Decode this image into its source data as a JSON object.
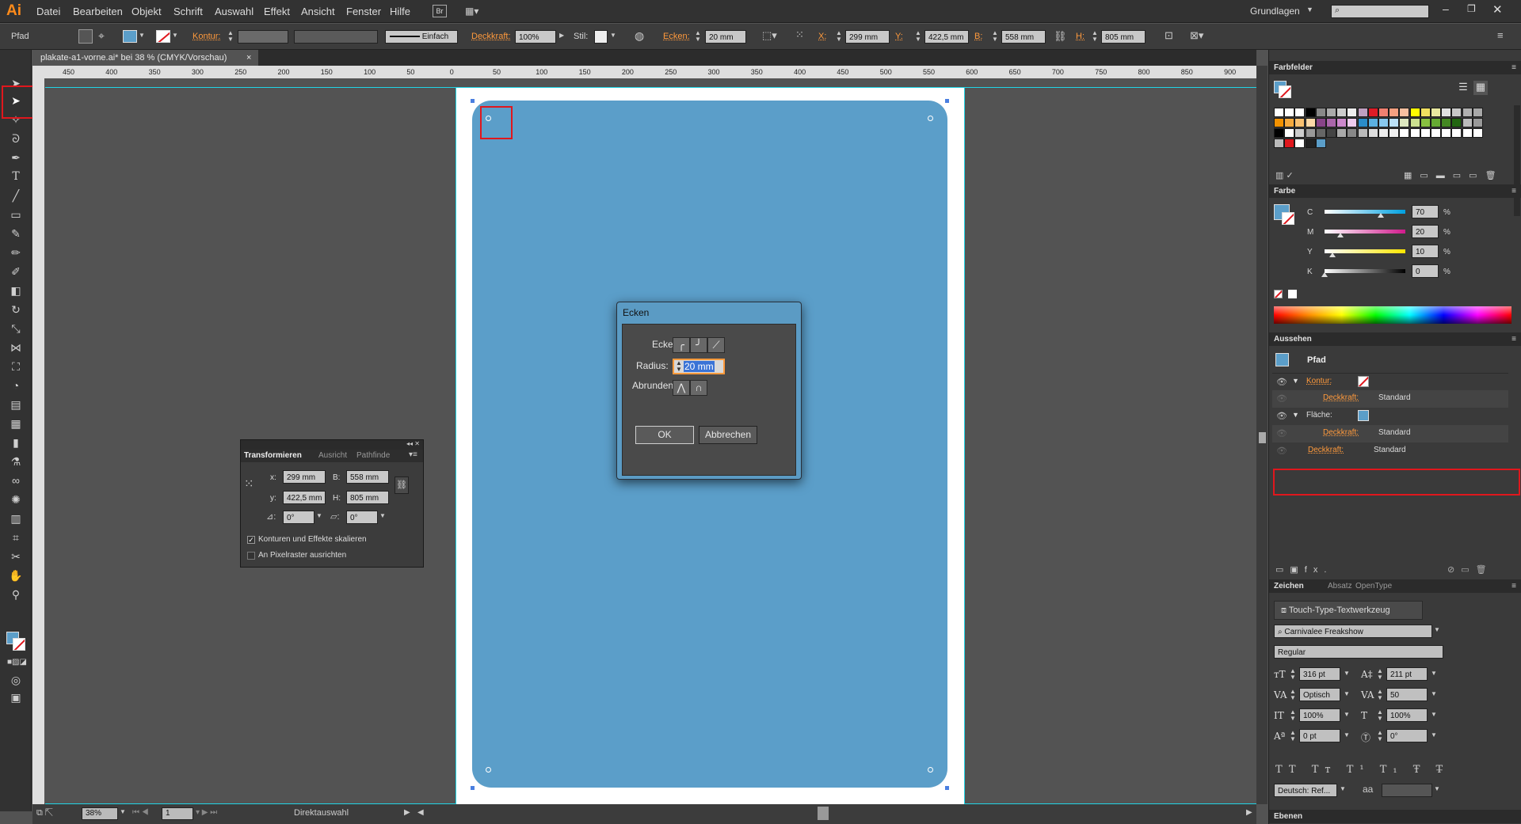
{
  "app": {
    "logo": "Ai",
    "menu": [
      "Datei",
      "Bearbeiten",
      "Objekt",
      "Schrift",
      "Auswahl",
      "Effekt",
      "Ansicht",
      "Fenster",
      "Hilfe"
    ],
    "bridge_badge": "Br",
    "workspace": "Grundlagen"
  },
  "control_bar": {
    "object_type": "Pfad",
    "kontur_label": "Kontur:",
    "stroke_style": "Einfach",
    "deckkraft_label": "Deckkraft:",
    "deckkraft_value": "100%",
    "stil_label": "Stil:",
    "ecken_label": "Ecken:",
    "ecken_value": "20 mm",
    "x_label": "X:",
    "x_value": "299 mm",
    "y_label": "Y:",
    "y_value": "422,5 mm",
    "b_label": "B:",
    "b_value": "558 mm",
    "h_label": "H:",
    "h_value": "805 mm"
  },
  "document": {
    "tab_title": "plakate-a1-vorne.ai* bei 38 % (CMYK/Vorschau)",
    "close_icon": "×"
  },
  "rulers": {
    "h_ticks": [
      "450",
      "400",
      "350",
      "300",
      "250",
      "200",
      "150",
      "100",
      "50",
      "0",
      "50",
      "100",
      "150",
      "200",
      "250",
      "300",
      "350",
      "400",
      "450",
      "500",
      "550",
      "600",
      "650",
      "700",
      "750",
      "800",
      "850",
      "900"
    ]
  },
  "status_bar": {
    "zoom": "38%",
    "artboard_number": "1",
    "tool_name": "Direktauswahl"
  },
  "transform_panel": {
    "tabs": [
      "Transformieren",
      "Ausricht",
      "Pathfinde"
    ],
    "x_label": "x:",
    "x_value": "299 mm",
    "y_label": "y:",
    "y_value": "422,5 mm",
    "b_label": "B:",
    "b_value": "558 mm",
    "h_label": "H:",
    "h_value": "805 mm",
    "rotate_value": "0°",
    "shear_value": "0°",
    "check1": "Konturen und Effekte skalieren",
    "check2": "An Pixelraster ausrichten"
  },
  "dialog": {
    "title": "Ecken",
    "ecke_label": "Ecke:",
    "radius_label": "Radius:",
    "radius_value": "20 mm",
    "abrunden_label": "Abrunden",
    "ok_label": "OK",
    "cancel_label": "Abbrechen"
  },
  "panels": {
    "farbfelder": "Farbfelder",
    "farbe": "Farbe",
    "cmyk": [
      {
        "label": "C",
        "value": "70",
        "unit": "%"
      },
      {
        "label": "M",
        "value": "20",
        "unit": "%"
      },
      {
        "label": "Y",
        "value": "10",
        "unit": "%"
      },
      {
        "label": "K",
        "value": "0",
        "unit": "%"
      }
    ],
    "aussehen": "Aussehen",
    "aussehen_rows": {
      "title": "Pfad",
      "kontur": "Kontur:",
      "deckkraft1": "Deckkraft:",
      "standard1": "Standard",
      "flaeche": "Fläche:",
      "deckkraft2": "Deckkraft:",
      "standard2": "Standard",
      "deckkraft3": "Deckkraft:",
      "standard3": "Standard"
    },
    "zeichen_tabs": [
      "Zeichen",
      "Absatz",
      "OpenType"
    ],
    "touch_type": "Touch-Type-Textwerkzeug",
    "font_family": "Carnivalee Freakshow",
    "font_style": "Regular",
    "font_size": "316 pt",
    "leading": "211 pt",
    "kerning": "Optisch",
    "tracking": "50",
    "vscale": "100%",
    "hscale": "100%",
    "baseline": "0 pt",
    "rotation": "0°",
    "language": "Deutsch: Ref...",
    "aa_label": "aa",
    "ebenen": "Ebenen"
  },
  "colors": {
    "fill": "#5b9ec9",
    "accent_orange": "#ff9a3c",
    "highlight_red": "#e0171d",
    "guide_cyan": "#21d5e6"
  }
}
